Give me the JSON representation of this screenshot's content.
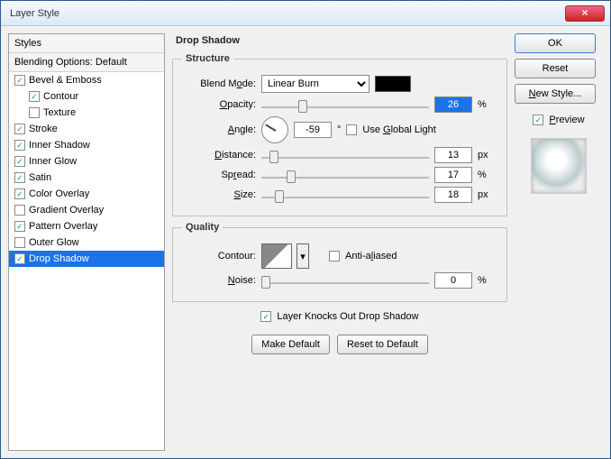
{
  "window": {
    "title": "Layer Style"
  },
  "styles": {
    "header": "Styles",
    "blending": "Blending Options: Default",
    "items": [
      {
        "label": "Bevel & Emboss",
        "checked": true,
        "indent": false
      },
      {
        "label": "Contour",
        "checked": true,
        "indent": true
      },
      {
        "label": "Texture",
        "checked": false,
        "indent": true
      },
      {
        "label": "Stroke",
        "checked": true,
        "indent": false
      },
      {
        "label": "Inner Shadow",
        "checked": true,
        "indent": false
      },
      {
        "label": "Inner Glow",
        "checked": true,
        "indent": false
      },
      {
        "label": "Satin",
        "checked": true,
        "indent": false
      },
      {
        "label": "Color Overlay",
        "checked": true,
        "indent": false
      },
      {
        "label": "Gradient Overlay",
        "checked": false,
        "indent": false
      },
      {
        "label": "Pattern Overlay",
        "checked": true,
        "indent": false
      },
      {
        "label": "Outer Glow",
        "checked": false,
        "indent": false
      },
      {
        "label": "Drop Shadow",
        "checked": true,
        "indent": false,
        "selected": true
      }
    ]
  },
  "panel": {
    "title": "Drop Shadow",
    "structure": {
      "legend": "Structure",
      "blendmode_label": "Blend Mode:",
      "blendmode_value": "Linear Burn",
      "color": "#000000",
      "opacity_label": "Opacity:",
      "opacity_value": "26",
      "opacity_unit": "%",
      "angle_label": "Angle:",
      "angle_value": "-59",
      "angle_unit": "°",
      "use_global_label": "Use Global Light",
      "use_global_checked": false,
      "distance_label": "Distance:",
      "distance_value": "13",
      "distance_unit": "px",
      "spread_label": "Spread:",
      "spread_value": "17",
      "spread_unit": "%",
      "size_label": "Size:",
      "size_value": "18",
      "size_unit": "px"
    },
    "quality": {
      "legend": "Quality",
      "contour_label": "Contour:",
      "antialiased_label": "Anti-aliased",
      "antialiased_checked": false,
      "noise_label": "Noise:",
      "noise_value": "0",
      "noise_unit": "%"
    },
    "knockout_label": "Layer Knocks Out Drop Shadow",
    "knockout_checked": true,
    "make_default": "Make Default",
    "reset_default": "Reset to Default"
  },
  "right": {
    "ok": "OK",
    "reset": "Reset",
    "newstyle": "New Style...",
    "preview_label": "Preview",
    "preview_checked": true
  }
}
